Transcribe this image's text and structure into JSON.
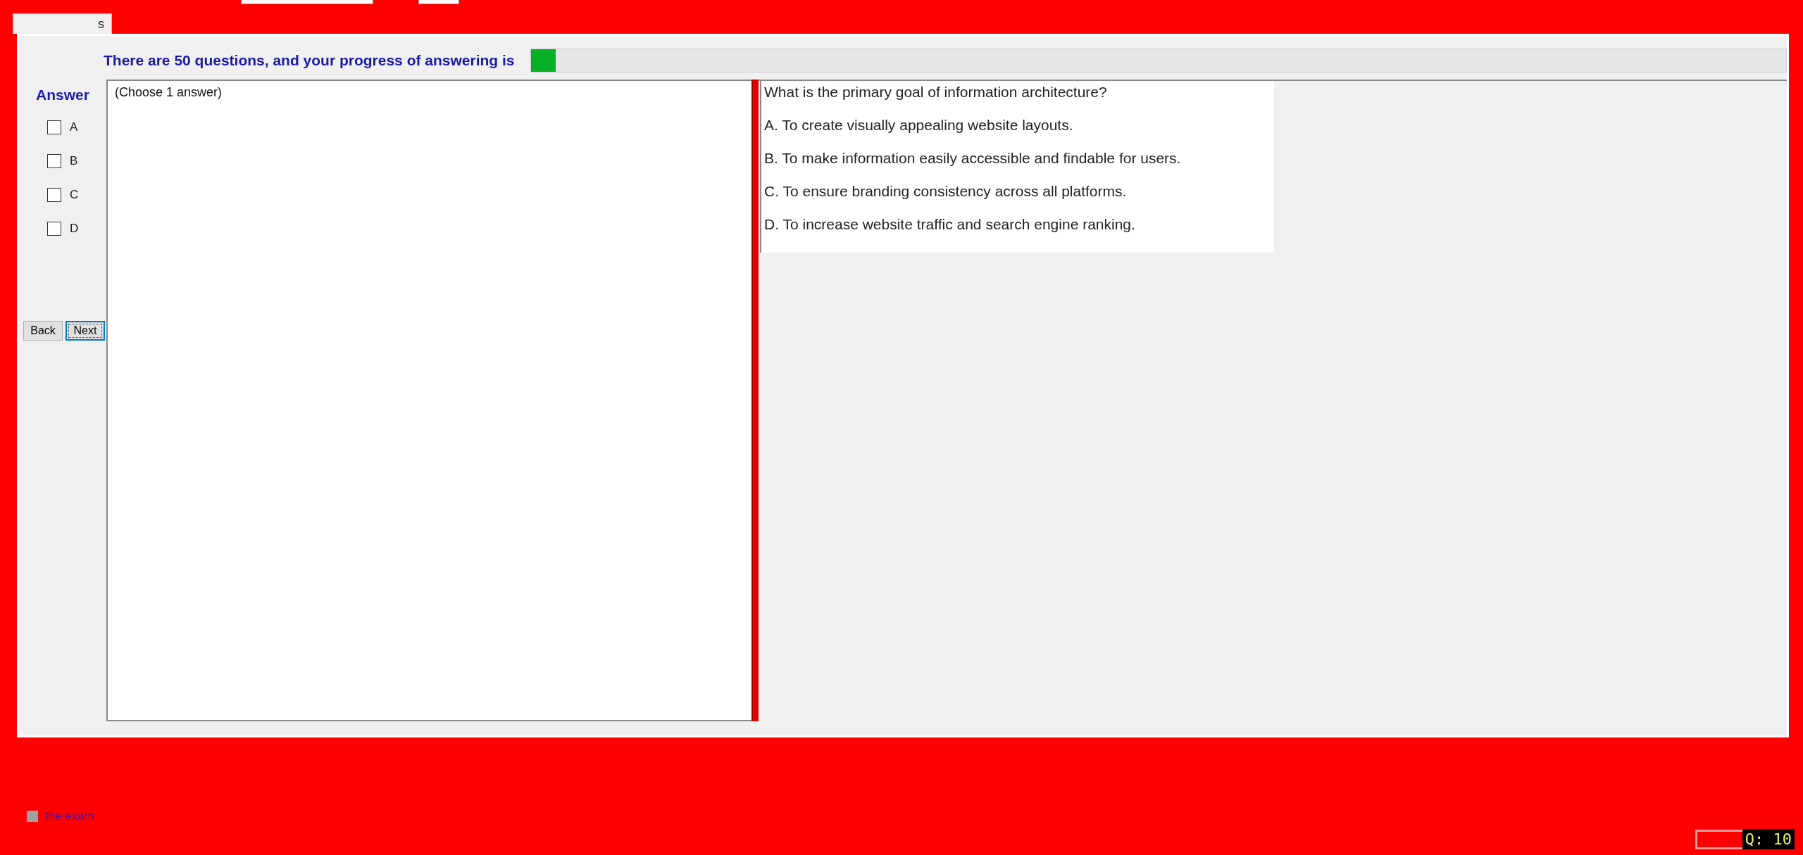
{
  "tab": {
    "label": "s"
  },
  "progress": {
    "label": "There are 50 questions, and your progress of answering is",
    "level": 0.02
  },
  "answer_panel": {
    "title": "Answer",
    "options": [
      {
        "label": "A",
        "checked": false
      },
      {
        "label": "B",
        "checked": false
      },
      {
        "label": "C",
        "checked": false
      },
      {
        "label": "D",
        "checked": false
      }
    ],
    "buttons": [
      {
        "label": "Back",
        "focused": false
      },
      {
        "label": "Next",
        "focused": true
      }
    ]
  },
  "instruction": "(Choose 1 answer)",
  "question": {
    "text": "What is the primary goal of information architecture?",
    "choices": [
      "A.  To create visually appealing website layouts.",
      "B.  To make information easily accessible and findable for users.",
      "C.  To ensure branding consistency across all platforms.",
      "D.  To increase website traffic and search engine ranking."
    ]
  },
  "finish": {
    "label": "the exam",
    "checked": false
  },
  "counter": "Q: 10"
}
